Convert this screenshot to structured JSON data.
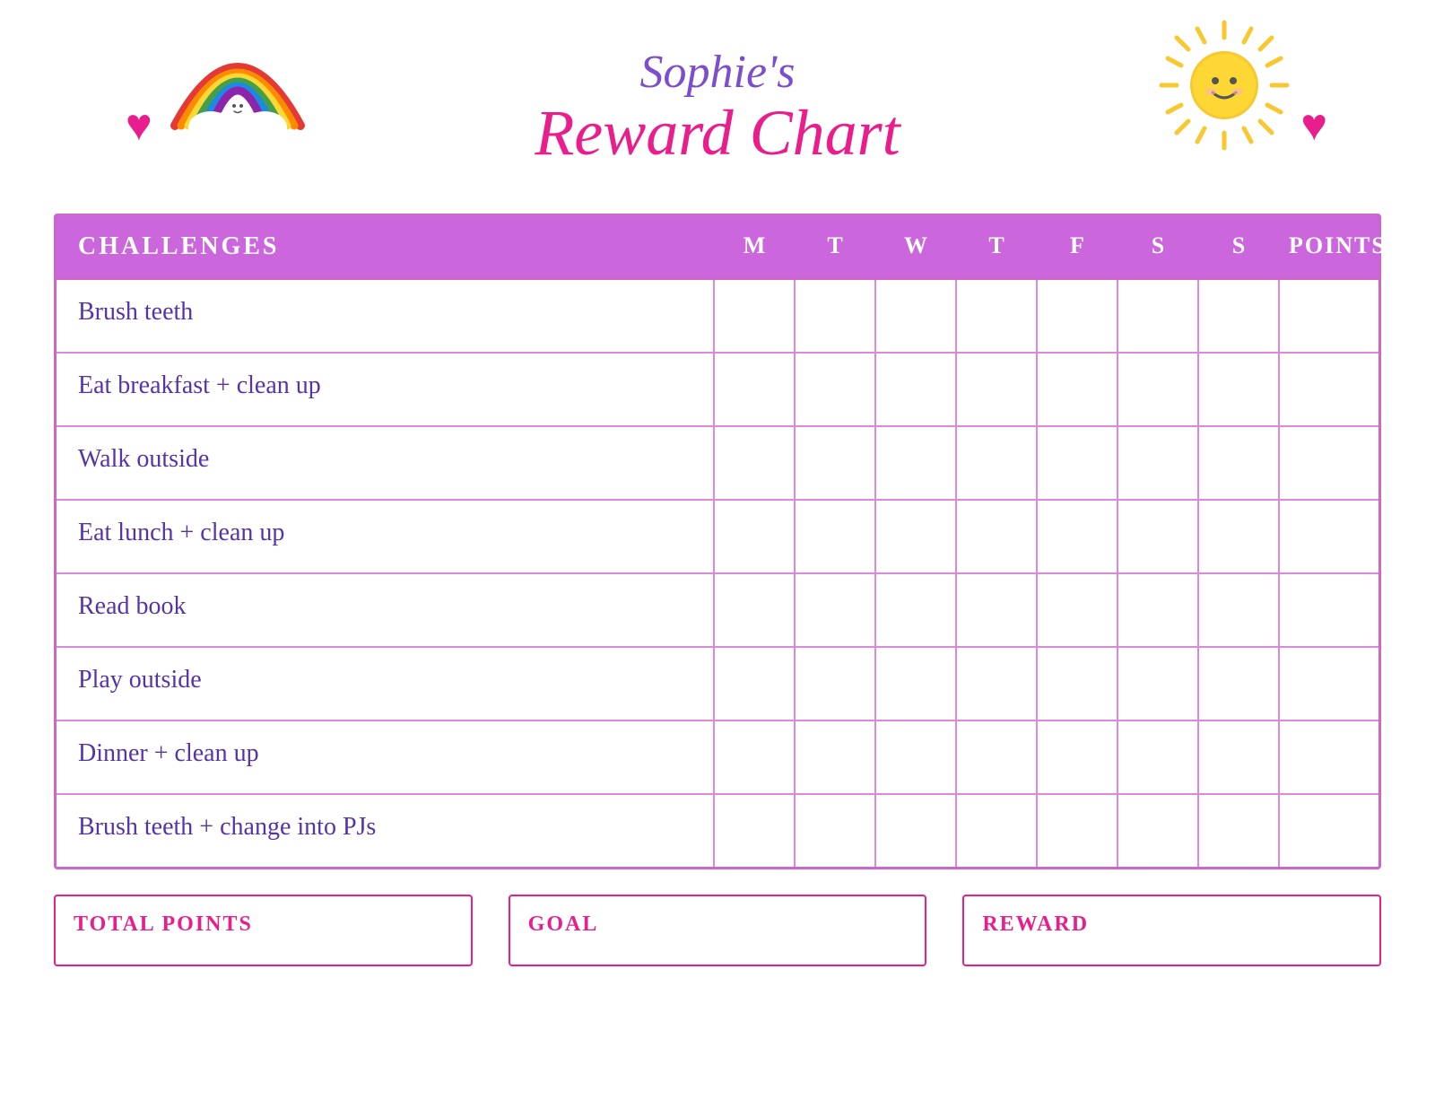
{
  "header": {
    "name_line": "Sophie's",
    "title_line": "Reward Chart"
  },
  "table": {
    "columns": {
      "challenges": "CHALLENGES",
      "days": [
        "M",
        "T",
        "W",
        "T",
        "F",
        "S",
        "S"
      ],
      "points": "POINTS"
    },
    "rows": [
      {
        "challenge": "Brush teeth"
      },
      {
        "challenge": "Eat breakfast + clean up"
      },
      {
        "challenge": "Walk outside"
      },
      {
        "challenge": "Eat lunch + clean up"
      },
      {
        "challenge": "Read book"
      },
      {
        "challenge": "Play outside"
      },
      {
        "challenge": "Dinner + clean up"
      },
      {
        "challenge": "Brush teeth + change into PJs"
      }
    ]
  },
  "footer": {
    "total_points": "TOTAL POINTS",
    "goal": "GOAL",
    "reward": "REWARD"
  },
  "icons": {
    "heart": "♥",
    "rainbow_alt": "🌈",
    "sun_alt": "☀"
  }
}
